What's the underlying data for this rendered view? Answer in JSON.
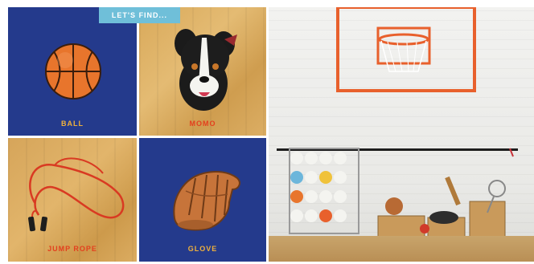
{
  "banner": {
    "text": "LET'S FIND..."
  },
  "cards": [
    {
      "label": "BALL",
      "icon": "basketball-icon"
    },
    {
      "label": "MOMO",
      "icon": "dog-icon"
    },
    {
      "label": "JUMP ROPE",
      "icon": "jump-rope-icon"
    },
    {
      "label": "GLOVE",
      "icon": "baseball-glove-icon"
    }
  ],
  "colors": {
    "blue_panel": "#243a8c",
    "label_yellow": "#f0b13c",
    "label_red": "#e3401e",
    "banner": "#6fbfd9",
    "backboard": "#e8602c"
  }
}
